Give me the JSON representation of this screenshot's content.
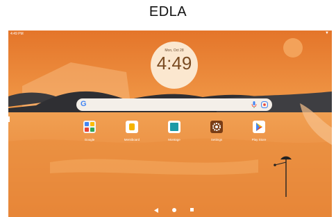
{
  "caption": "EDLA",
  "status_bar": {
    "time": "4:49 PM"
  },
  "clock": {
    "date": "Mon, Oct 28",
    "time": "4:49"
  },
  "search": {
    "logo": "G"
  },
  "apps": [
    {
      "label": "Google",
      "icon": "google-folder-icon"
    },
    {
      "label": "Mentiboard",
      "icon": "mentiboard-icon"
    },
    {
      "label": "Montage",
      "icon": "montage-icon"
    },
    {
      "label": "Settings",
      "icon": "gear-icon"
    },
    {
      "label": "Play Store",
      "icon": "play-store-icon"
    }
  ],
  "colors": {
    "sky": "#e8852f",
    "sun": "#f3a25a",
    "clock_bg": "#fbe7cf"
  }
}
